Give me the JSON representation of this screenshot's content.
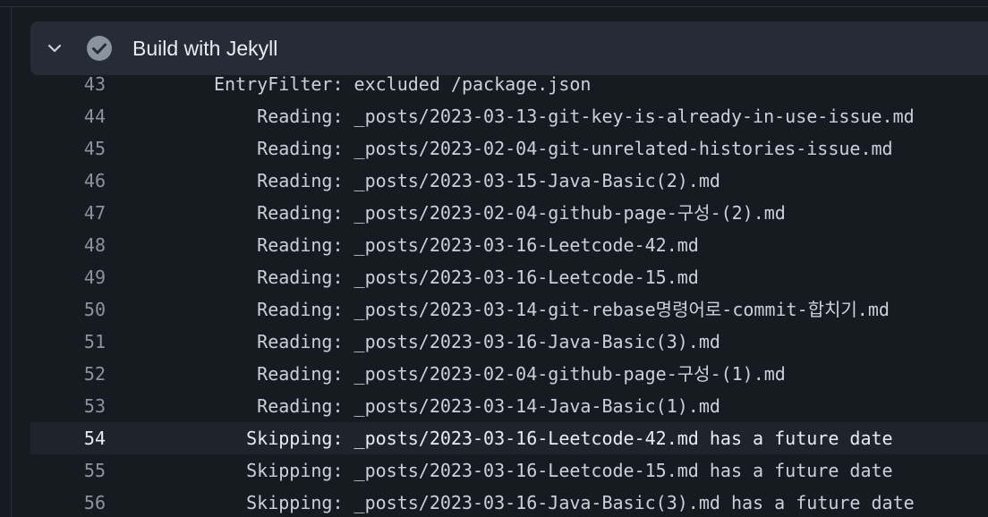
{
  "step": {
    "title": "Build with Jekyll",
    "status": "success",
    "status_color": "#8b949e",
    "expand_icon": "chevron-down-icon",
    "status_icon": "check-circle-icon"
  },
  "log": [
    {
      "num": "43",
      "text": "EntryFilter: excluded /package.json"
    },
    {
      "num": "44",
      "text": "    Reading: _posts/2023-03-13-git-key-is-already-in-use-issue.md"
    },
    {
      "num": "45",
      "text": "    Reading: _posts/2023-02-04-git-unrelated-histories-issue.md"
    },
    {
      "num": "46",
      "text": "    Reading: _posts/2023-03-15-Java-Basic(2).md"
    },
    {
      "num": "47",
      "text": "    Reading: _posts/2023-02-04-github-page-구성-(2).md"
    },
    {
      "num": "48",
      "text": "    Reading: _posts/2023-03-16-Leetcode-42.md"
    },
    {
      "num": "49",
      "text": "    Reading: _posts/2023-03-16-Leetcode-15.md"
    },
    {
      "num": "50",
      "text": "    Reading: _posts/2023-03-14-git-rebase명령어로-commit-합치기.md"
    },
    {
      "num": "51",
      "text": "    Reading: _posts/2023-03-16-Java-Basic(3).md"
    },
    {
      "num": "52",
      "text": "    Reading: _posts/2023-02-04-github-page-구성-(1).md"
    },
    {
      "num": "53",
      "text": "    Reading: _posts/2023-03-14-Java-Basic(1).md"
    },
    {
      "num": "54",
      "text": "   Skipping: _posts/2023-03-16-Leetcode-42.md has a future date"
    },
    {
      "num": "55",
      "text": "   Skipping: _posts/2023-03-16-Leetcode-15.md has a future date"
    },
    {
      "num": "56",
      "text": "   Skipping: _posts/2023-03-16-Java-Basic(3).md has a future date"
    }
  ]
}
